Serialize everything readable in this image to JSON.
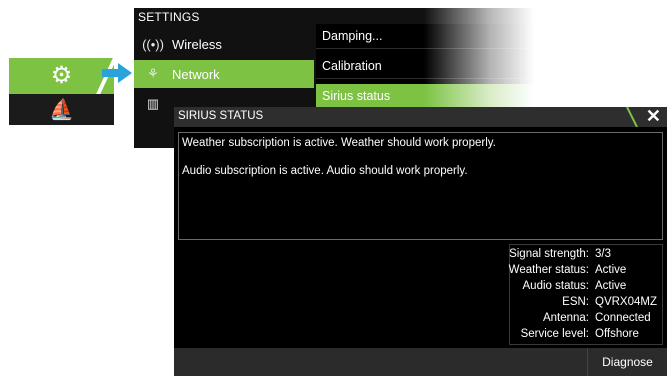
{
  "colors": {
    "accent": "#7dc243",
    "arrow": "#2aa3dc",
    "panel": "#111111",
    "dialog": "#000000"
  },
  "thumbnail": {
    "top_icon": "gear-icon",
    "bottom_icon": "boat-icon"
  },
  "settings": {
    "title": "SETTINGS",
    "items": [
      {
        "label": "Wireless",
        "icon": "wireless-icon"
      },
      {
        "label": "Network",
        "icon": "network-icon"
      },
      {
        "label": "",
        "icon": "vessels-icon"
      }
    ],
    "submenu": [
      "Damping...",
      "Calibration",
      "Sirius status"
    ]
  },
  "dialog": {
    "title": "SIRIUS STATUS",
    "messages": [
      "Weather subscription is active. Weather should work properly.",
      "Audio subscription is active. Audio should work properly."
    ],
    "status": [
      {
        "label": "Signal strength:",
        "value": "3/3"
      },
      {
        "label": "Weather status:",
        "value": "Active"
      },
      {
        "label": "Audio status:",
        "value": "Active"
      },
      {
        "label": "ESN:",
        "value": "QVRX04MZ"
      },
      {
        "label": "Antenna:",
        "value": "Connected"
      },
      {
        "label": "Service level:",
        "value": "Offshore"
      }
    ],
    "diagnose_label": "Diagnose"
  }
}
